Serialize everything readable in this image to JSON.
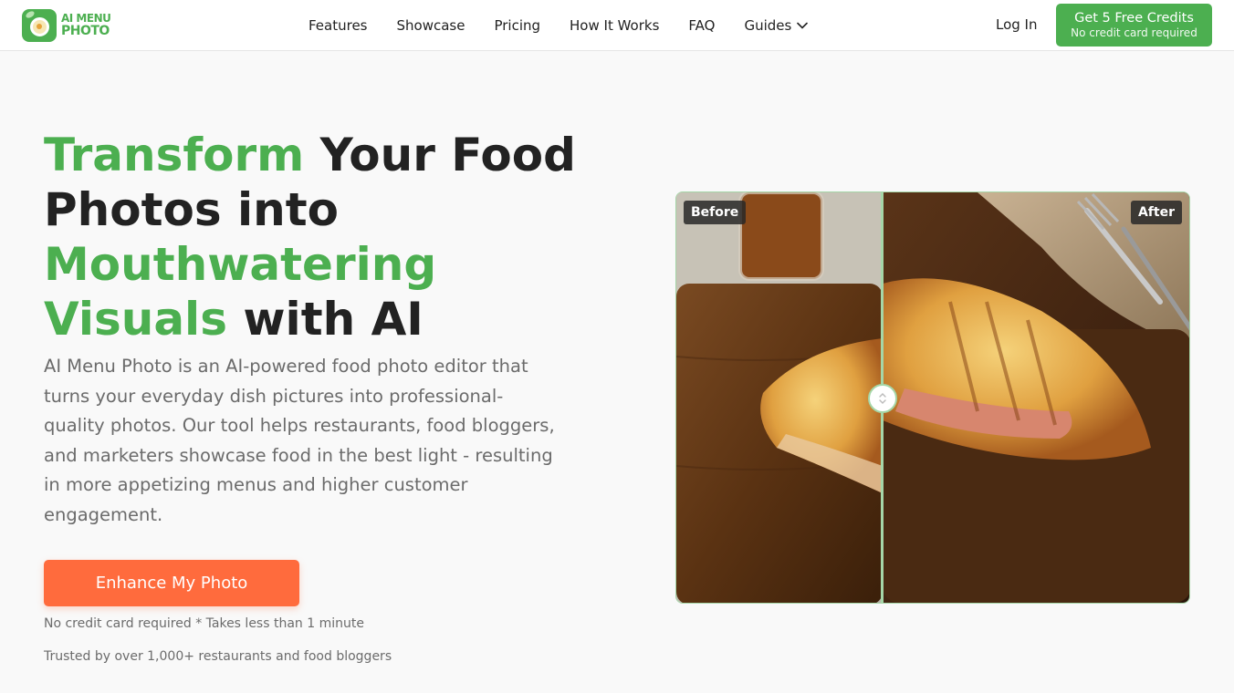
{
  "brand": {
    "logo_line1": "AI MENU",
    "logo_line2": "PHOTO",
    "accent": "#4caf50",
    "cta_color": "#ff6b3d"
  },
  "nav": {
    "items": [
      {
        "label": "Features"
      },
      {
        "label": "Showcase"
      },
      {
        "label": "Pricing"
      },
      {
        "label": "How It Works"
      },
      {
        "label": "FAQ"
      },
      {
        "label": "Guides",
        "icon": "chevron-down-icon"
      }
    ],
    "login": "Log In",
    "cta_main": "Get 5 Free Credits",
    "cta_sub": "No credit card required"
  },
  "hero": {
    "title_parts": {
      "p1": "Transform",
      "p2": " Your Food Photos into ",
      "p3": "Mouthwatering Visuals",
      "p4": " with AI"
    },
    "description": "AI Menu Photo is an AI-powered food photo editor that turns your everyday dish pictures into professional-quality photos. Our tool helps restaurants, food bloggers, and marketers showcase food in the best light - resulting in more appetizing menus and higher customer engagement.",
    "button": "Enhance My Photo",
    "note1": "No credit card required * Takes less than 1 minute",
    "note2": "Trusted by over 1,000+ restaurants and food bloggers"
  },
  "compare": {
    "before_label": "Before",
    "after_label": "After",
    "slider_position": 0.4
  }
}
